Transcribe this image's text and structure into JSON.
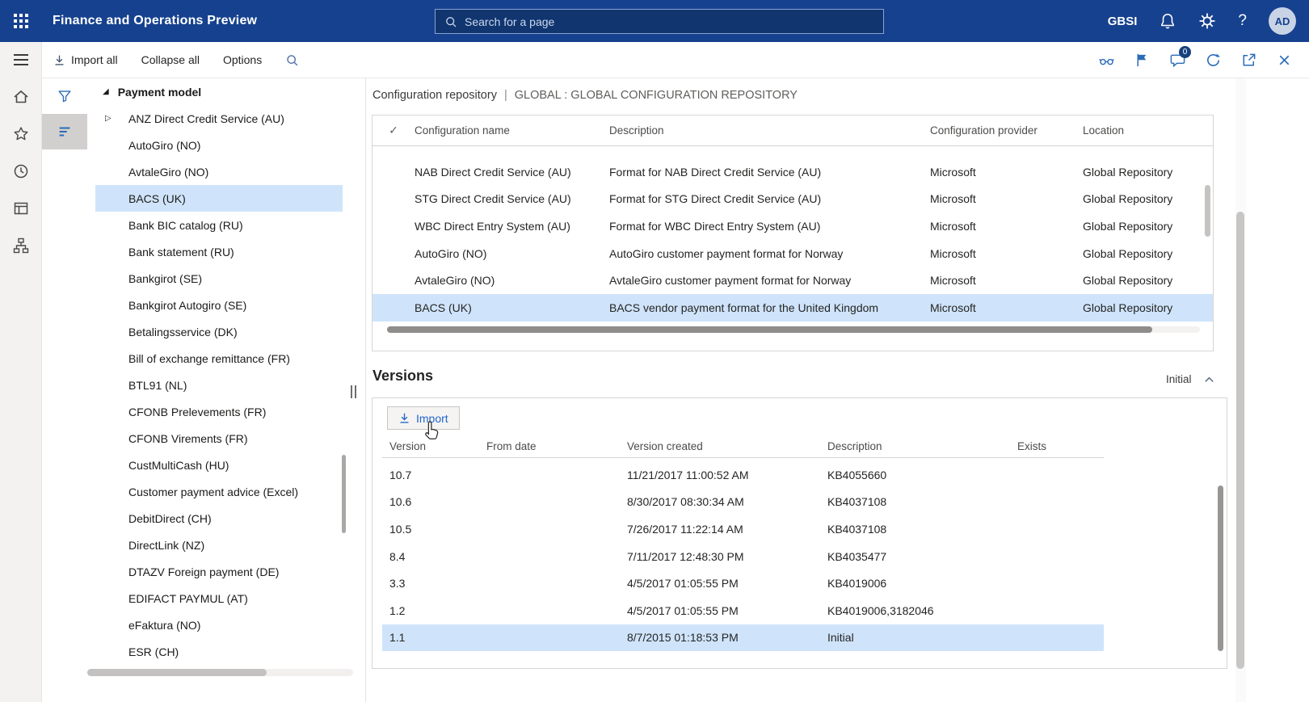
{
  "topbar": {
    "app_title": "Finance and Operations Preview",
    "search_placeholder": "Search for a page",
    "company": "GBSI",
    "avatar_initials": "AD"
  },
  "command_bar": {
    "import_all_label": "Import all",
    "collapse_all_label": "Collapse all",
    "options_label": "Options",
    "message_badge": "0"
  },
  "navigation_tree": {
    "root_label": "Payment model",
    "selected_item": "BACS (UK)",
    "expandable_item": "ANZ Direct Credit Service (AU)",
    "items": [
      "ANZ Direct Credit Service (AU)",
      "AutoGiro (NO)",
      "AvtaleGiro (NO)",
      "BACS (UK)",
      "Bank BIC catalog (RU)",
      "Bank statement (RU)",
      "Bankgirot (SE)",
      "Bankgirot Autogiro (SE)",
      "Betalingsservice (DK)",
      "Bill of exchange remittance (FR)",
      "BTL91 (NL)",
      "CFONB Prelevements (FR)",
      "CFONB Virements (FR)",
      "CustMultiCash (HU)",
      "Customer payment advice (Excel)",
      "DebitDirect (CH)",
      "DirectLink (NZ)",
      "DTAZV Foreign payment (DE)",
      "EDIFACT PAYMUL (AT)",
      "eFaktura (NO)",
      "ESR (CH)"
    ]
  },
  "content": {
    "breadcrumb_title": "Configuration repository",
    "breadcrumb_separator": "|",
    "breadcrumb_context": "GLOBAL : GLOBAL CONFIGURATION REPOSITORY",
    "repository_grid": {
      "columns": [
        "Configuration name",
        "Description",
        "Configuration provider",
        "Location"
      ],
      "selected_row_index": 5,
      "rows": [
        [
          "NAB Direct Credit Service (AU)",
          "Format for NAB Direct Credit Service (AU)",
          "Microsoft",
          "Global Repository"
        ],
        [
          "STG Direct Credit Service (AU)",
          "Format for STG Direct Credit Service (AU)",
          "Microsoft",
          "Global Repository"
        ],
        [
          "WBC Direct Entry System (AU)",
          "Format for WBC Direct Entry System (AU)",
          "Microsoft",
          "Global Repository"
        ],
        [
          "AutoGiro (NO)",
          "AutoGiro customer payment format for Norway",
          "Microsoft",
          "Global Repository"
        ],
        [
          "AvtaleGiro (NO)",
          "AvtaleGiro customer payment format for Norway",
          "Microsoft",
          "Global Repository"
        ],
        [
          "BACS (UK)",
          "BACS vendor payment format for the United Kingdom",
          "Microsoft",
          "Global Repository"
        ]
      ]
    },
    "versions_section": {
      "title": "Versions",
      "summary_value": "Initial",
      "import_button_label": "Import",
      "columns": [
        "Version",
        "From date",
        "Version created",
        "Description",
        "Exists"
      ],
      "selected_row_index": 6,
      "rows": [
        [
          "10.7",
          "",
          "11/21/2017 11:00:52 AM",
          "KB4055660",
          ""
        ],
        [
          "10.6",
          "",
          "8/30/2017 08:30:34 AM",
          "KB4037108",
          ""
        ],
        [
          "10.5",
          "",
          "7/26/2017 11:22:14 AM",
          "KB4037108",
          ""
        ],
        [
          "8.4",
          "",
          "7/11/2017 12:48:30 PM",
          "KB4035477",
          ""
        ],
        [
          "3.3",
          "",
          "4/5/2017 01:05:55 PM",
          "KB4019006",
          ""
        ],
        [
          "1.2",
          "",
          "4/5/2017 01:05:55 PM",
          "KB4019006,3182046",
          ""
        ],
        [
          "1.1",
          "",
          "8/7/2015 01:18:53 PM",
          "Initial",
          ""
        ]
      ]
    }
  },
  "icons": {
    "select-all": "✓",
    "expanded-triangle": "◢",
    "collapsed-triangle": "▷",
    "help": "?"
  },
  "colors": {
    "topbar_bg": "#16418e",
    "selection_bg": "#cfe4fa",
    "accent_blue": "#2266c9"
  }
}
